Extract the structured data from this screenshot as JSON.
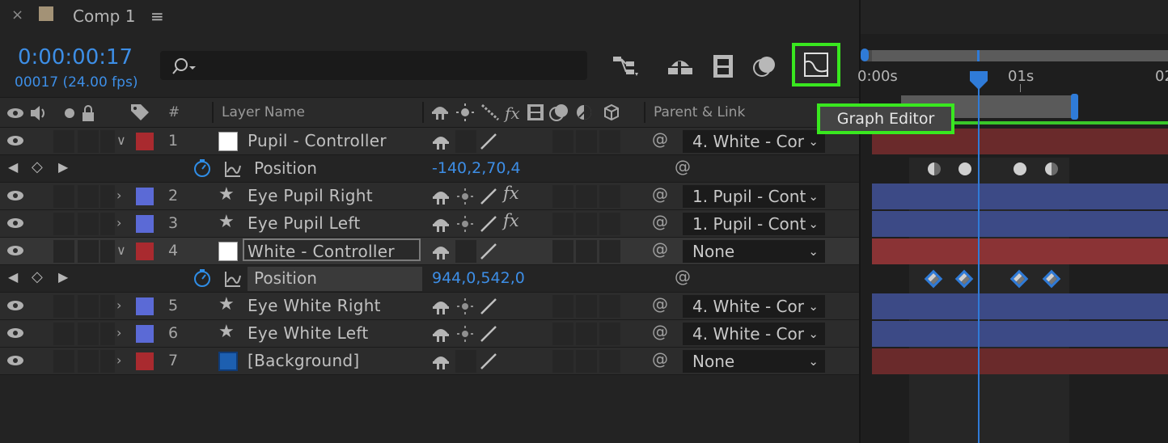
{
  "panel": {
    "close_glyph": "×",
    "title": "Comp 1",
    "menu_glyph": "≡",
    "swatch_color": "#a39276"
  },
  "time": {
    "timecode": "0:00:00:17",
    "frame_fps": "00017 (24.00 fps)"
  },
  "search": {
    "placeholder": "",
    "icon": "search-icon"
  },
  "toolbar": {
    "tools": [
      "composition-mini-flowchart-icon",
      "draft-3d-icon",
      "frame-blending-icon",
      "motion-blur-icon",
      "graph-editor-icon"
    ],
    "tooltip": "Graph Editor"
  },
  "header": {
    "hash": "#",
    "layer_name": "Layer Name",
    "parent_link": "Parent & Link"
  },
  "timeline": {
    "ruler_labels": [
      "0:00s",
      "01s",
      "02"
    ],
    "playhead_color": "#2f7bd8",
    "work_area_color": "#39c72a"
  },
  "layers": [
    {
      "num": "1",
      "name": "Pupil - Controller",
      "label_color": "#a92a2f",
      "source": "white-box",
      "expanded": true,
      "parent": "4. White - Cor",
      "fx": false,
      "bar": "red"
    },
    {
      "num": "2",
      "name": "Eye Pupil Right",
      "label_color": "#5b6ad6",
      "source": "star",
      "expanded": false,
      "parent": "1. Pupil - Cont",
      "fx": true,
      "bar": "blue"
    },
    {
      "num": "3",
      "name": "Eye Pupil Left",
      "label_color": "#5b6ad6",
      "source": "star",
      "expanded": false,
      "parent": "1. Pupil - Cont",
      "fx": true,
      "bar": "blue"
    },
    {
      "num": "4",
      "name": "White - Controller",
      "label_color": "#a92a2f",
      "source": "white-box",
      "expanded": true,
      "parent": "None",
      "fx": false,
      "bar": "red"
    },
    {
      "num": "5",
      "name": "Eye White Right",
      "label_color": "#5b6ad6",
      "source": "star",
      "expanded": false,
      "parent": "4. White - Cor",
      "fx": false,
      "bar": "blue"
    },
    {
      "num": "6",
      "name": "Eye White Left",
      "label_color": "#5b6ad6",
      "source": "star",
      "expanded": false,
      "parent": "4. White - Cor",
      "fx": false,
      "bar": "blue"
    },
    {
      "num": "7",
      "name": "[Background]",
      "label_color": "#a92a2f",
      "source": "blue-box",
      "expanded": false,
      "parent": "None",
      "fx": false,
      "bar": "red"
    }
  ],
  "properties": [
    {
      "name": "Position",
      "value": "-140,2,70,4"
    },
    {
      "name": "Position",
      "value": "944,0,542,0"
    }
  ],
  "glyphs": {
    "expanded": "∨",
    "collapsed": "›",
    "star": "★",
    "fx": "fx",
    "dropdown": "⌄",
    "spiral": "@",
    "prev": "◀",
    "diamond": "◇",
    "next": "▶"
  }
}
